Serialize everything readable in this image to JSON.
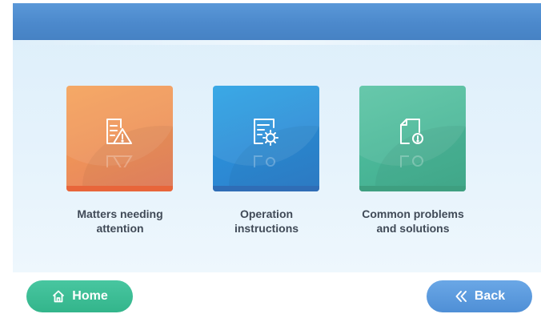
{
  "cards": [
    {
      "label_line1": "Matters needing",
      "label_line2": "attention",
      "icon": "document-warning-icon",
      "color": "#ee9358"
    },
    {
      "label_line1": "Operation",
      "label_line2": "instructions",
      "icon": "document-settings-icon",
      "color": "#2b8cd6"
    },
    {
      "label_line1": "Common problems",
      "label_line2": "and solutions",
      "icon": "file-alert-icon",
      "color": "#4ab798"
    }
  ],
  "footer": {
    "home_label": "Home",
    "home_icon": "home-icon",
    "back_label": "Back",
    "back_icon": "double-chevron-left-icon"
  },
  "colors": {
    "header": "#4c89cc",
    "home_button": "#33b58b",
    "back_button": "#4f8fd6"
  }
}
